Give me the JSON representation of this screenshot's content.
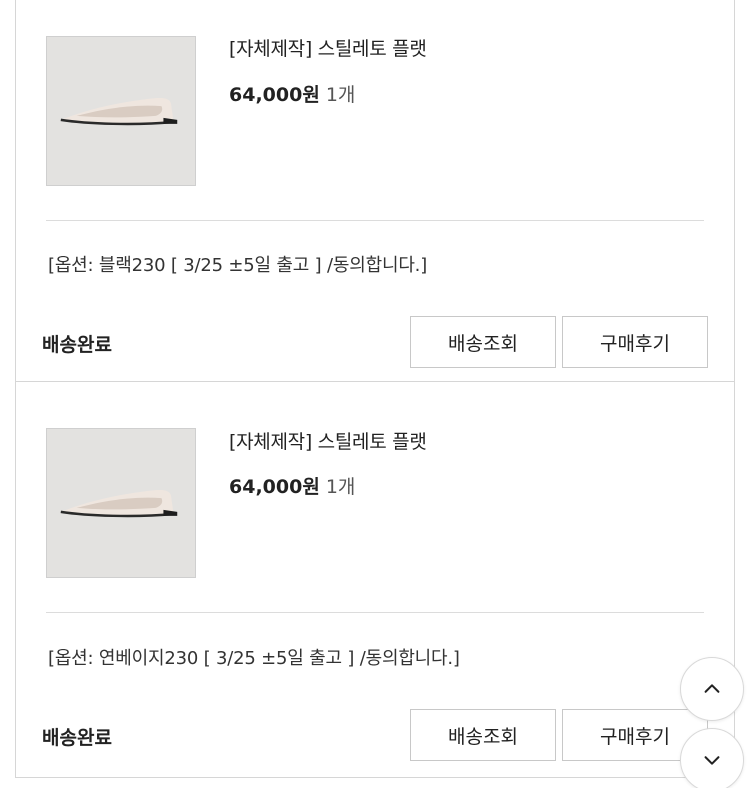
{
  "orders": [
    {
      "product_name": "[자체제작] 스틸레토 플랫",
      "price": "64,000원",
      "quantity": "1개",
      "option": "[옵션: 블랙230 [ 3/25 ±5일 출고 ] /동의합니다.]",
      "status": "배송완료",
      "track_label": "배송조회",
      "review_label": "구매후기"
    },
    {
      "product_name": "[자체제작] 스틸레토 플랫",
      "price": "64,000원",
      "quantity": "1개",
      "option": "[옵션: 연베이지230 [ 3/25 ±5일 출고 ] /동의합니다.]",
      "status": "배송완료",
      "track_label": "배송조회",
      "review_label": "구매후기"
    }
  ],
  "icons": {
    "product_image": "shoe-product-image",
    "scroll_up": "chevron-up-icon",
    "scroll_down": "chevron-down-icon"
  }
}
